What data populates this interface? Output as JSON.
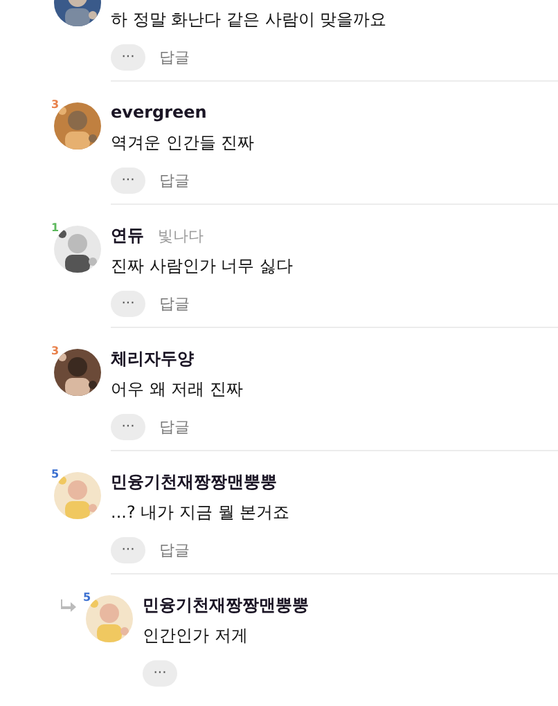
{
  "comments": [
    {
      "text": "하 정말 화난다 같은 사람이 맞을까요",
      "more": "···",
      "reply": "답글"
    },
    {
      "level": {
        "text": "3",
        "color": "#e8804a"
      },
      "name": "evergreen",
      "text": "역겨운 인간들 진짜",
      "more": "···",
      "reply": "답글"
    },
    {
      "level": {
        "text": "1",
        "color": "#5cb85c"
      },
      "name": "연듀",
      "tag": "빛나다",
      "text": "진짜 사람인가 너무 싫다",
      "more": "···",
      "reply": "답글"
    },
    {
      "level": {
        "text": "3",
        "color": "#e8804a"
      },
      "name": "체리자두양",
      "text": "어우 왜 저래 진짜",
      "more": "···",
      "reply": "답글"
    },
    {
      "level": {
        "text": "5",
        "color": "#3a6fd0"
      },
      "name": "민융기천재짱짱맨뿡뿡",
      "text": "...? 내가 지금 뭘 본거죠",
      "more": "···",
      "reply": "답글",
      "replies": [
        {
          "level": {
            "text": "5",
            "color": "#3a6fd0"
          },
          "name": "민융기천재짱짱맨뿡뿡",
          "text": "인간인가 저게",
          "more": "···"
        }
      ]
    }
  ]
}
